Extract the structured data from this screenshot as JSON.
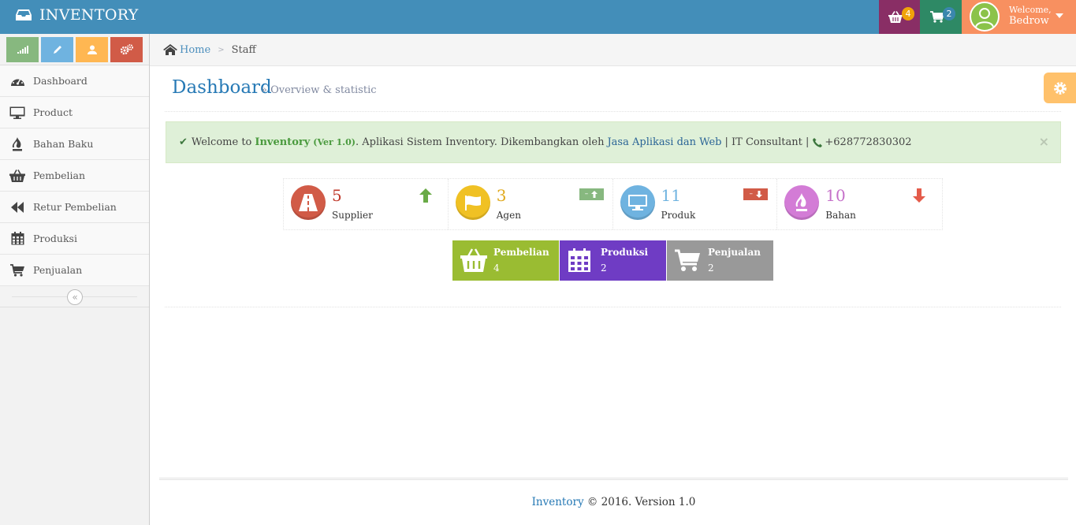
{
  "navbar": {
    "brand": "INVENTORY",
    "basket_count": "4",
    "cart_count": "2",
    "welcome": "Welcome,",
    "username": "Bedrow"
  },
  "sidebar": {
    "items": [
      {
        "label": "Dashboard",
        "icon": "tachometer-icon"
      },
      {
        "label": "Product",
        "icon": "desktop-icon"
      },
      {
        "label": "Bahan Baku",
        "icon": "fire-icon"
      },
      {
        "label": "Pembelian",
        "icon": "basket-icon"
      },
      {
        "label": "Retur Pembelian",
        "icon": "backward-icon"
      },
      {
        "label": "Produksi",
        "icon": "calendar-icon"
      },
      {
        "label": "Penjualan",
        "icon": "cart-icon"
      }
    ],
    "collapse_glyph": "«"
  },
  "breadcrumb": {
    "home": "Home",
    "current": "Staff"
  },
  "header": {
    "title": "Dashboard",
    "subtitle": "» Overview & statistic"
  },
  "alert": {
    "prefix": "Welcome to",
    "app": "Inventory",
    "version": "(Ver 1.0)",
    "text": ". Aplikasi Sistem Inventory. Dikembangkan oleh",
    "link": "Jasa Aplikasi dan Web",
    "suffix": "| IT Consultant |",
    "phone": "+628772830302",
    "close": "×"
  },
  "stats": [
    {
      "value": "5",
      "label": "Supplier",
      "color": "#d15b47"
    },
    {
      "value": "3",
      "label": "Agen",
      "color": "#e0a91c"
    },
    {
      "value": "11",
      "label": "Produk",
      "color": "#6fb3e0"
    },
    {
      "value": "10",
      "label": "Bahan",
      "color": "#c570c9"
    }
  ],
  "tiles": [
    {
      "title": "Pembelian",
      "value": "4",
      "color": "#9abc32"
    },
    {
      "title": "Produksi",
      "value": "2",
      "color": "#6f3cc4"
    },
    {
      "title": "Penjualan",
      "value": "2",
      "color": "#999999"
    }
  ],
  "footer": {
    "brand": "Inventory",
    "text": "© 2016. Version 1.0"
  }
}
